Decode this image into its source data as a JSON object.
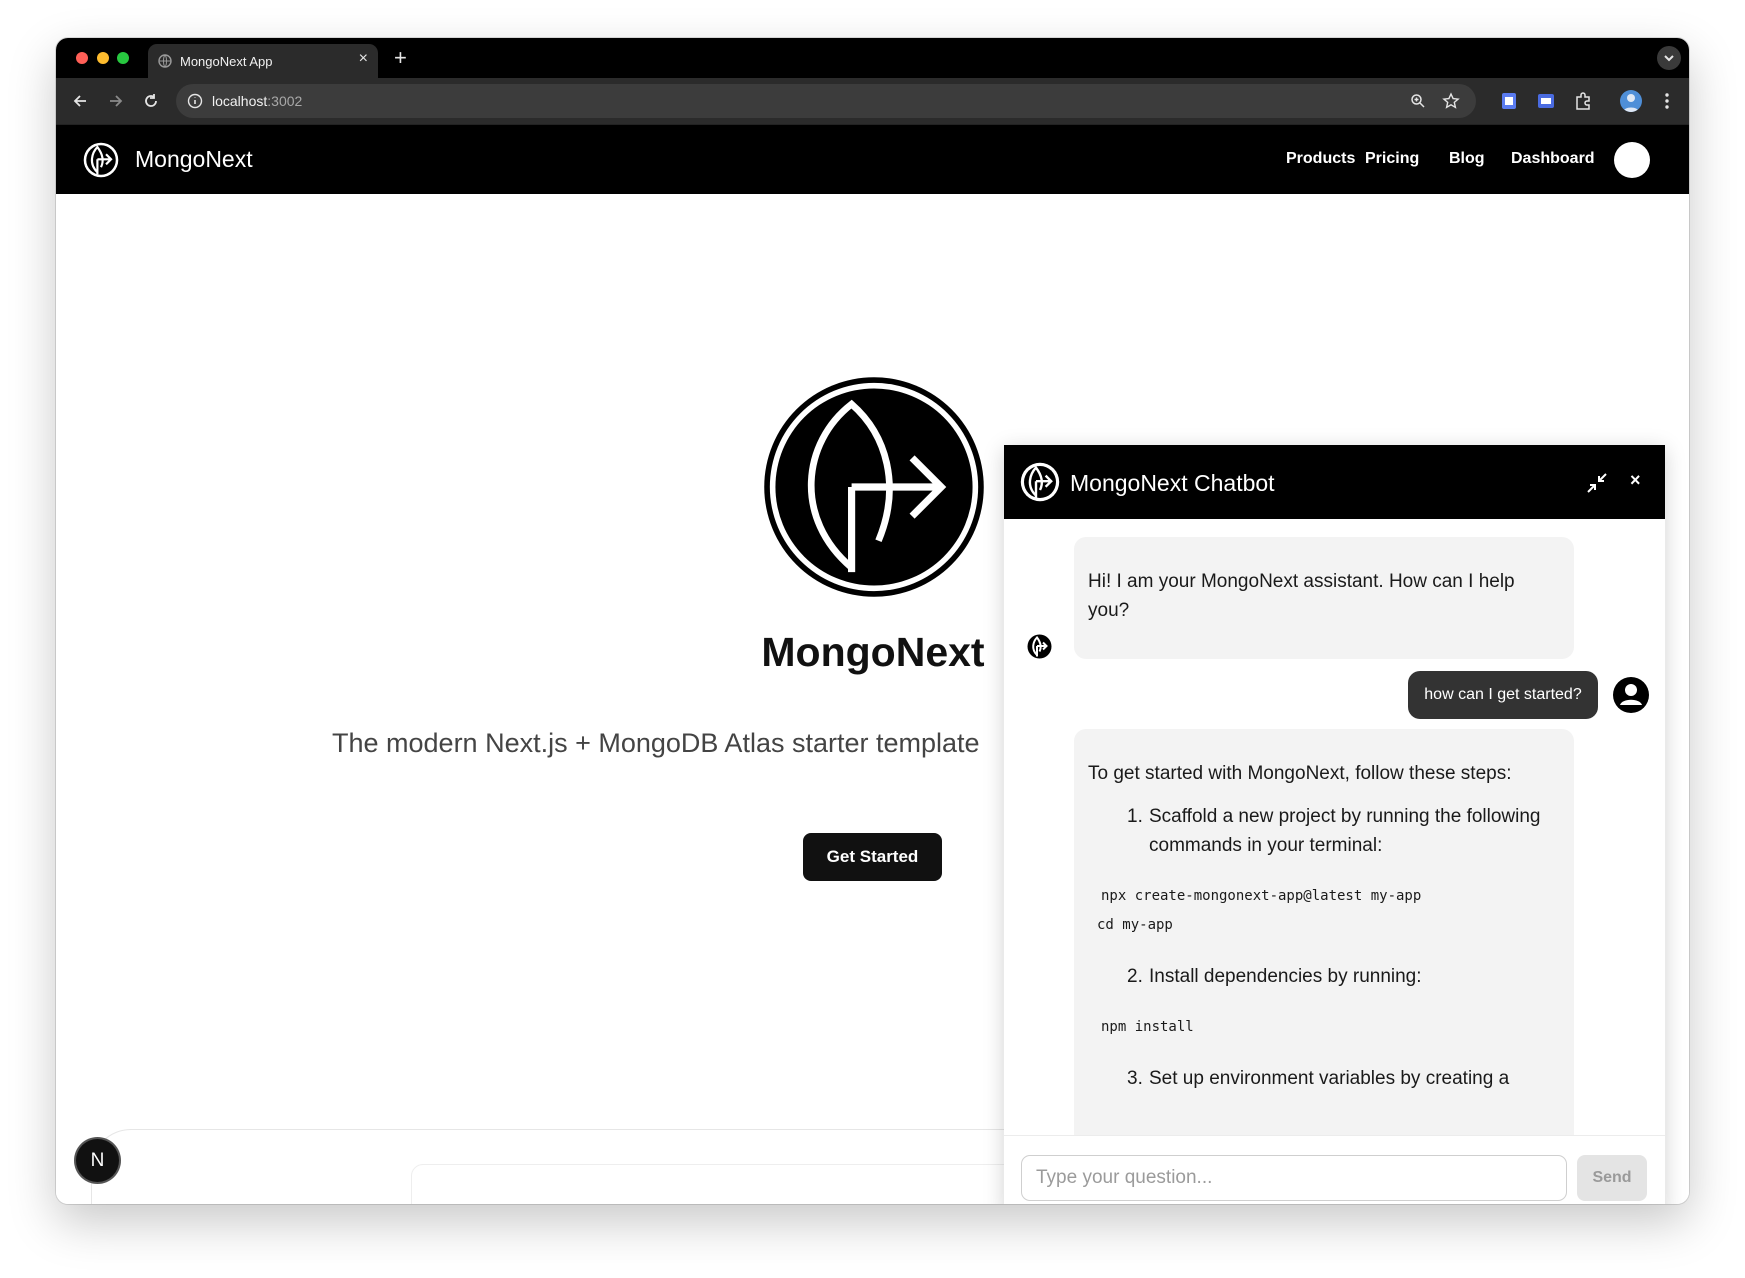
{
  "browser": {
    "tab_title": "MongoNext App",
    "tab_close": "×",
    "new_tab": "+",
    "url_host": "localhost",
    "url_port": ":3002"
  },
  "site": {
    "brand": "MongoNext",
    "nav": [
      "Products",
      "Pricing",
      "Blog",
      "Dashboard"
    ]
  },
  "hero": {
    "title": "MongoNext",
    "subtitle": "The modern Next.js + MongoDB Atlas starter template",
    "cta": "Get Started"
  },
  "next_badge": "N",
  "chatbot": {
    "title": "MongoNext Chatbot",
    "close": "×",
    "greeting": "Hi! I am your MongoNext assistant. How can I help you?",
    "user_message": "how can I get started?",
    "reply": {
      "intro": "To get started with MongoNext, follow these steps:",
      "step1_num": "1.",
      "step1": "Scaffold a new project by running the following commands in your terminal:",
      "code1_line1": "npx create-mongonext-app@latest my-app",
      "code1_line2": "cd my-app",
      "step2_num": "2.",
      "step2": "Install dependencies by running:",
      "code2": "npm install",
      "step3_num": "3.",
      "step3": "Set up environment variables by creating a"
    },
    "input_placeholder": "Type your question...",
    "send": "Send"
  },
  "colors": {
    "header_bg": "#000000",
    "bubble_bg": "#f3f3f3",
    "user_bubble_bg": "#333333",
    "cta_bg": "#111111"
  }
}
